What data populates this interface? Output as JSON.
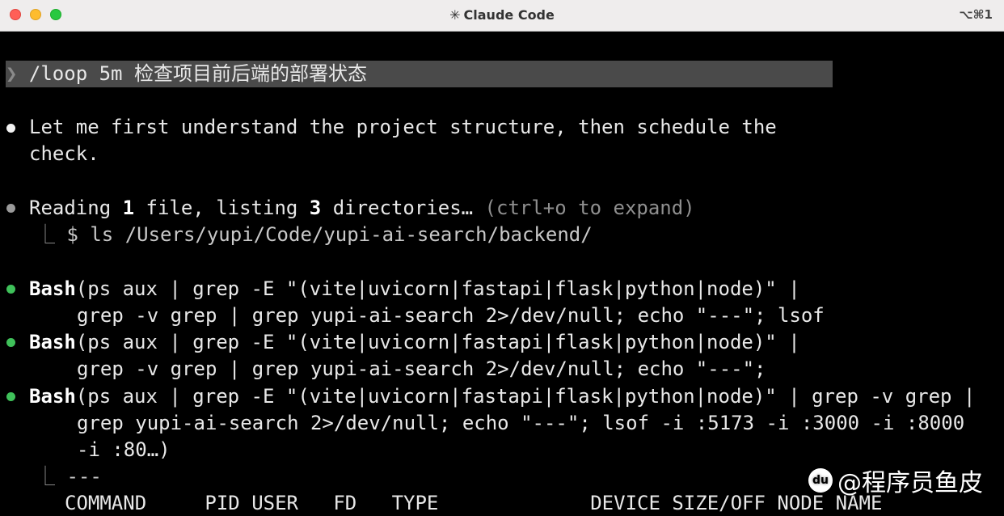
{
  "window": {
    "title": "Claude Code",
    "title_icon": "✳",
    "shortcut": "⌥⌘1"
  },
  "prompt": {
    "chevron": "❯",
    "text": "/loop 5m 检查项目前后端的部署状态"
  },
  "messages": [
    {
      "line1": "Let me first understand the project structure, then schedule the",
      "line2": "check."
    }
  ],
  "reading": {
    "prefix": "Reading ",
    "count1": "1",
    "mid": " file, listing ",
    "count2": "3",
    "suffix": " directories… ",
    "hint": "(ctrl+o to expand)",
    "elbow": "⎿",
    "command": "$ ls /Users/yupi/Code/yupi-ai-search/backend/"
  },
  "bash_calls": [
    {
      "tool": "Bash",
      "line1": "(ps aux | grep -E \"(vite|uvicorn|fastapi|flask|python|node)\" |",
      "line2": "grep -v grep | grep yupi-ai-search 2>/dev/null; echo \"---\"; lsof"
    },
    {
      "tool": "Bash",
      "line1": "(ps aux | grep -E \"(vite|uvicorn|fastapi|flask|python|node)\" |",
      "line2": "grep -v grep | grep yupi-ai-search 2>/dev/null; echo \"---\";"
    },
    {
      "tool": "Bash",
      "line1": "(ps aux | grep -E \"(vite|uvicorn|fastapi|flask|python|node)\" | grep -v grep |",
      "line2": "grep yupi-ai-search 2>/dev/null; echo \"---\"; lsof -i :5173 -i :3000 -i :8000",
      "line3": "-i :80…)"
    }
  ],
  "output": {
    "elbow": "⎿",
    "separator": "---",
    "header": "COMMAND     PID USER   FD   TYPE             DEVICE SIZE/OFF NODE NAME"
  },
  "watermark": {
    "logo": "du",
    "text": "@程序员鱼皮"
  }
}
